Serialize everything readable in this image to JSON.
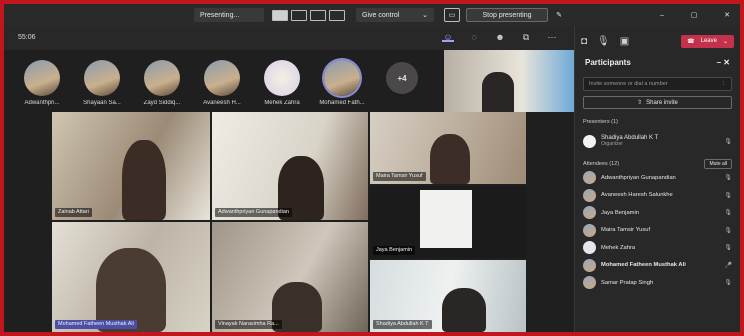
{
  "topbar": {
    "presenting_label": "Presenting...",
    "give_control_label": "Give control",
    "stop_presenting_label": "Stop presenting"
  },
  "callbar": {
    "timer": "55:06"
  },
  "avatars": [
    {
      "name": "Adwanthpri..."
    },
    {
      "name": "Shayaan Sa..."
    },
    {
      "name": "Zayd Siddiq..."
    },
    {
      "name": "Avaneesh H..."
    },
    {
      "name": "Mehek Zahra"
    },
    {
      "name": "Mohamed Fath..."
    }
  ],
  "more_count": "+4",
  "tiles": [
    {
      "label": "Zainab Attari"
    },
    {
      "label": "Adwanthpriyan Gunapandian"
    },
    {
      "label": "Maira Tamsir Yusuf"
    },
    {
      "label": "Jaya Benjamin"
    },
    {
      "label": "Mohamed Fatheen Musthak Ali"
    },
    {
      "label": "Vinayak Narasimha Ra..."
    },
    {
      "label": "Shadiya Abdullah K T"
    }
  ],
  "panel": {
    "leave_label": "Leave",
    "title": "Participants",
    "invite_placeholder": "Invite someone or dial a number",
    "share_invite_label": "Share invite",
    "presenters_label": "Presenters (1)",
    "presenter": {
      "name": "Shadiya Abdullah K T",
      "role": "Organizer"
    },
    "attendees_label": "Attendees (12)",
    "mute_all_label": "Mute all",
    "attendees": [
      {
        "name": "Adwanthpriyan Gunapandian"
      },
      {
        "name": "Avaneesh Haresh Salunkhe"
      },
      {
        "name": "Jaya Benjamin"
      },
      {
        "name": "Maira Tamsir Yusuf"
      },
      {
        "name": "Mehek Zahra"
      },
      {
        "name": "Mohamed Fatheen Musthak Ali"
      },
      {
        "name": "Samar Pratap Singh"
      }
    ]
  },
  "colors": {
    "frame_border": "#c0161d",
    "leave": "#c4314b",
    "accent": "#9ea2ff"
  }
}
